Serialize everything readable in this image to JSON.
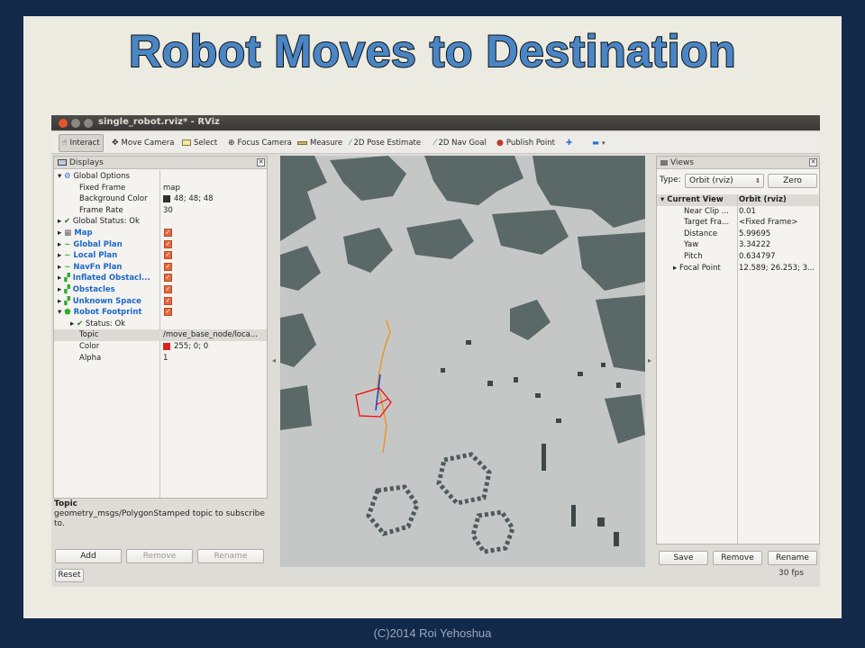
{
  "slide": {
    "title": "Robot Moves to Destination",
    "footer": "(C)2014 Roi Yehoshua"
  },
  "window": {
    "title": "single_robot.rviz* - RViz"
  },
  "toolbar": {
    "items": [
      {
        "label": "Interact",
        "icon": "hand-pointer-icon"
      },
      {
        "label": "Move Camera",
        "icon": "move-camera-icon"
      },
      {
        "label": "Select",
        "icon": "select-rectangle-icon"
      },
      {
        "label": "Focus Camera",
        "icon": "focus-target-icon"
      },
      {
        "label": "Measure",
        "icon": "ruler-icon"
      },
      {
        "label": "2D Pose Estimate",
        "icon": "green-arrow-icon"
      },
      {
        "label": "2D Nav Goal",
        "icon": "green-arrow-icon"
      },
      {
        "label": "Publish Point",
        "icon": "pin-icon"
      }
    ]
  },
  "displays": {
    "title": "Displays",
    "rows": [
      {
        "name": "Global Options",
        "value": ""
      },
      {
        "name": "Fixed Frame",
        "value": "map"
      },
      {
        "name": "Background Color",
        "value": "48; 48; 48"
      },
      {
        "name": "Frame Rate",
        "value": "30"
      },
      {
        "name": "Global Status: Ok",
        "value": ""
      },
      {
        "name": "Map",
        "value": ""
      },
      {
        "name": "Global Plan",
        "value": ""
      },
      {
        "name": "Local Plan",
        "value": ""
      },
      {
        "name": "NavFn Plan",
        "value": ""
      },
      {
        "name": "Inflated Obstacl...",
        "value": ""
      },
      {
        "name": "Obstacles",
        "value": ""
      },
      {
        "name": "Unknown Space",
        "value": ""
      },
      {
        "name": "Robot Footprint",
        "value": ""
      },
      {
        "name": "Status: Ok",
        "value": ""
      },
      {
        "name": "Topic",
        "value": "/move_base_node/loca..."
      },
      {
        "name": "Color",
        "value": "255; 0; 0"
      },
      {
        "name": "Alpha",
        "value": "1"
      }
    ],
    "description_title": "Topic",
    "description_text": "geometry_msgs/PolygonStamped topic to subscribe to.",
    "buttons": {
      "add": "Add",
      "remove": "Remove",
      "rename": "Rename"
    },
    "reset": "Reset",
    "background_color_hex": "#303030",
    "footprint_color_hex": "#ff0000"
  },
  "views": {
    "title": "Views",
    "type_label": "Type:",
    "type_value": "Orbit (rviz)",
    "zero_label": "Zero",
    "header": {
      "name": "Current View",
      "value": "Orbit (rviz)"
    },
    "rows": [
      {
        "name": "Near Clip ...",
        "value": "0.01"
      },
      {
        "name": "Target Fra...",
        "value": "<Fixed Frame>"
      },
      {
        "name": "Distance",
        "value": "5.99695"
      },
      {
        "name": "Yaw",
        "value": "3.34222"
      },
      {
        "name": "Pitch",
        "value": "0.634797"
      },
      {
        "name": "Focal Point",
        "value": "12.589; 26.253; 3..."
      }
    ],
    "buttons": {
      "save": "Save",
      "remove": "Remove",
      "rename": "Rename"
    }
  },
  "status": {
    "fps": "30 fps"
  },
  "colors": {
    "map_obstacle": "#5b6868",
    "map_free": "#c5c7c6",
    "global_plan": "#e8972b",
    "robot_footprint": "#ff0000",
    "accent_blue": "#1d68c8"
  }
}
